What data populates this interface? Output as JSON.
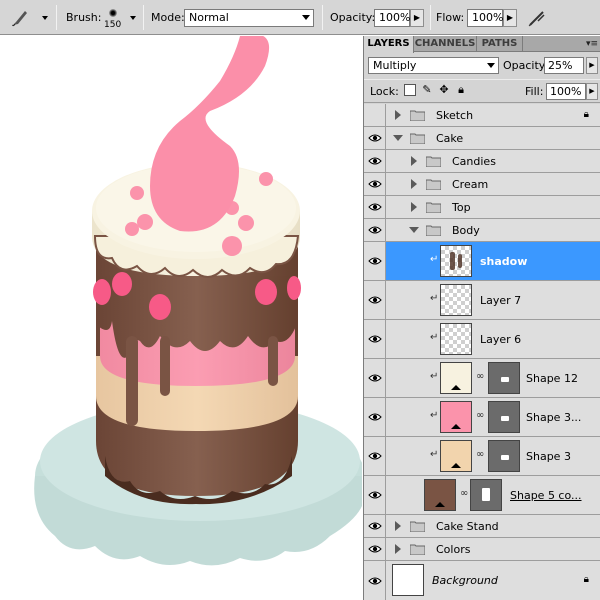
{
  "options_bar": {
    "brush_label": "Brush:",
    "brush_size": "150",
    "mode_label": "Mode:",
    "mode_value": "Normal",
    "opacity_label": "Opacity:",
    "opacity_value": "100%",
    "flow_label": "Flow:",
    "flow_value": "100%"
  },
  "panel": {
    "tabs": [
      "LAYERS",
      "CHANNELS",
      "PATHS"
    ],
    "blend_mode": "Multiply",
    "opacity_label": "Opacity:",
    "opacity_value": "25%",
    "lock_label": "Lock:",
    "fill_label": "Fill:",
    "fill_value": "100%",
    "layers": [
      {
        "name": "Sketch",
        "type": "group",
        "expanded": false,
        "visible": false,
        "locked": true
      },
      {
        "name": "Cake",
        "type": "group",
        "expanded": true,
        "visible": true
      },
      {
        "name": "Candies",
        "type": "group",
        "expanded": false,
        "visible": true
      },
      {
        "name": "Cream",
        "type": "group",
        "expanded": false,
        "visible": true
      },
      {
        "name": "Top",
        "type": "group",
        "expanded": false,
        "visible": true
      },
      {
        "name": "Body",
        "type": "group",
        "expanded": true,
        "visible": true
      },
      {
        "name": "shadow",
        "type": "layer",
        "visible": true,
        "selected": true
      },
      {
        "name": "Layer 7",
        "type": "layer",
        "visible": true
      },
      {
        "name": "Layer 6",
        "type": "layer",
        "visible": true
      },
      {
        "name": "Shape 12",
        "type": "shape",
        "visible": true,
        "color": "#f7f2e0"
      },
      {
        "name": "Shape 3...",
        "type": "shape",
        "visible": true,
        "color": "#fb93ab"
      },
      {
        "name": "Shape 3",
        "type": "shape",
        "visible": true,
        "color": "#f2d4ad"
      },
      {
        "name": "Shape 5 co...",
        "type": "shape",
        "visible": true,
        "color": "#7a5444"
      },
      {
        "name": "Cake Stand",
        "type": "group",
        "expanded": false,
        "visible": true
      },
      {
        "name": "Colors",
        "type": "group",
        "expanded": false,
        "visible": true
      },
      {
        "name": "Background",
        "type": "background",
        "visible": true,
        "locked": true
      }
    ]
  },
  "colors": {
    "selected_row": "#3b98ff",
    "cake_brown": "#7a5444",
    "cake_pink": "#fb93ab",
    "cream": "#f7f2e0",
    "stand": "#c5ddda"
  }
}
